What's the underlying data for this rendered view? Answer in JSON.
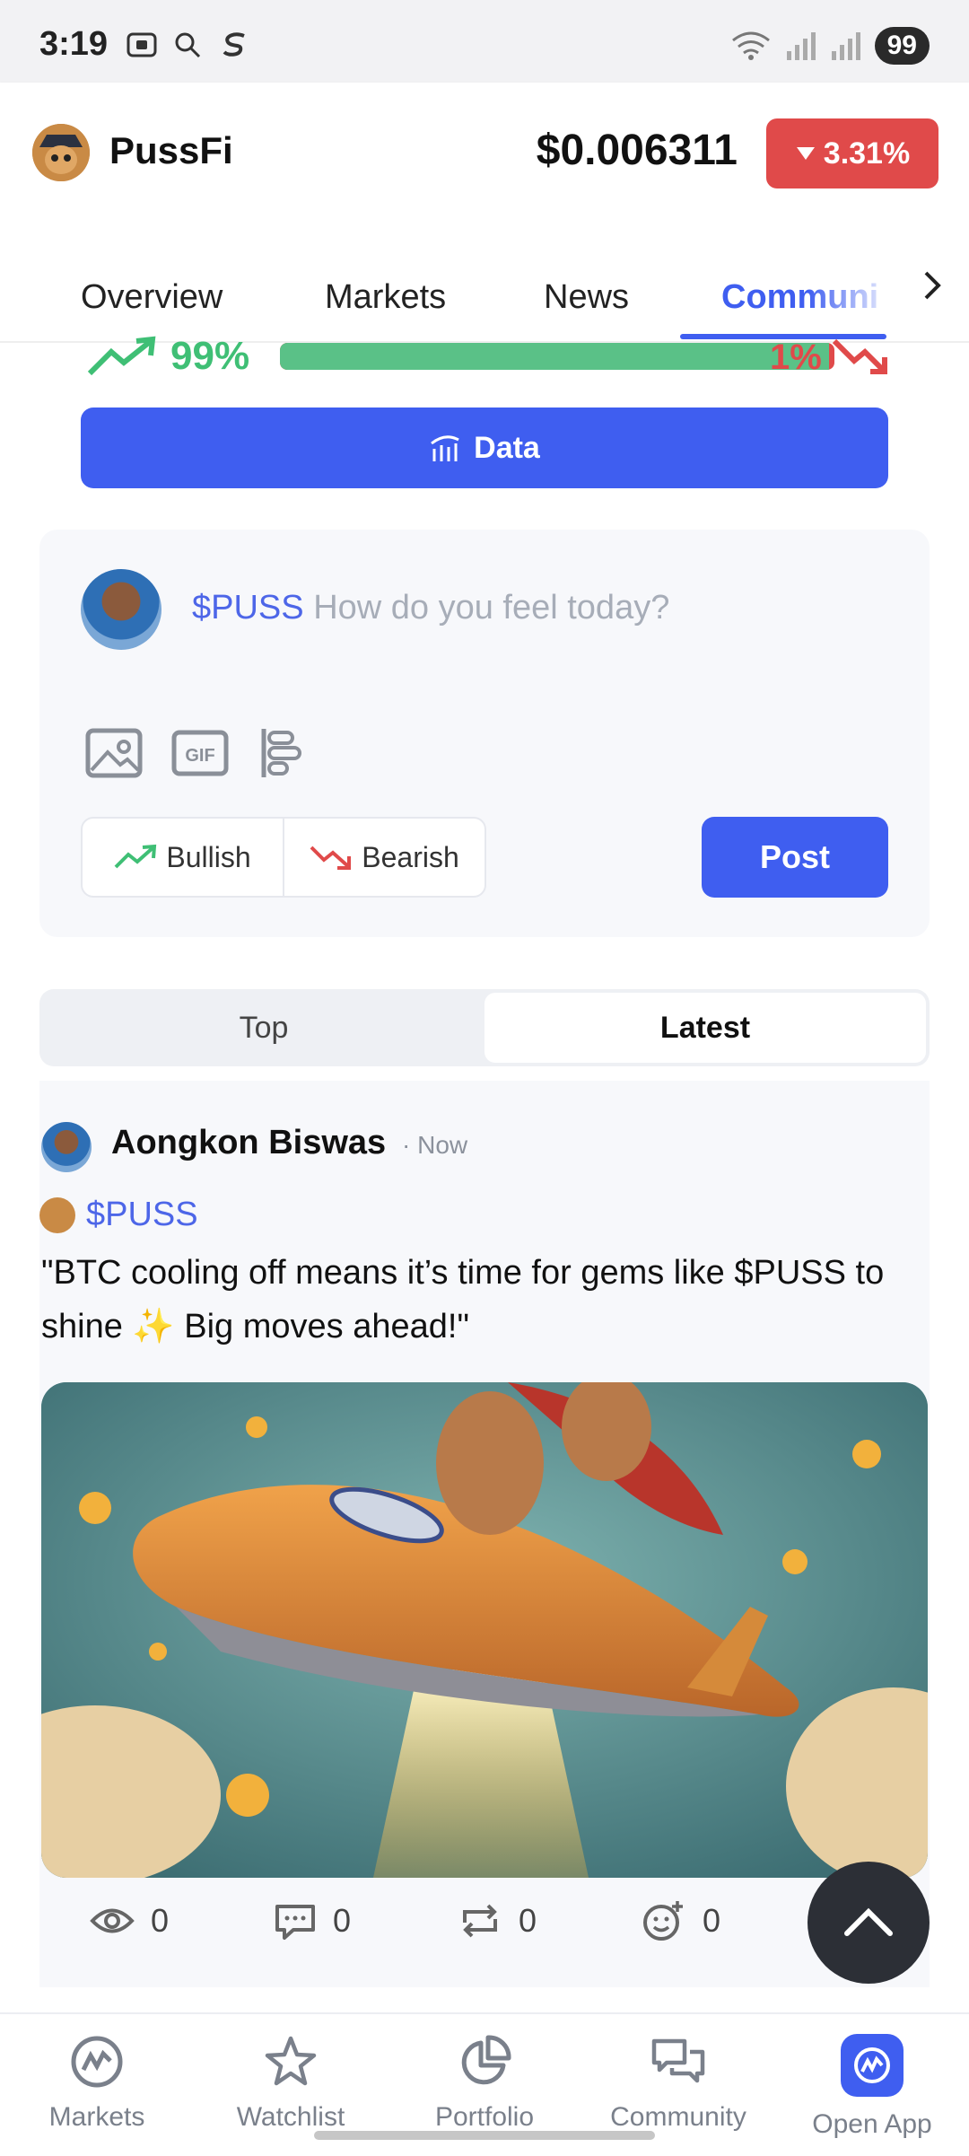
{
  "status_bar": {
    "time": "3:19",
    "battery": "99"
  },
  "header": {
    "token_name": "PussFi",
    "price": "$0.006311",
    "change": "3.31%",
    "change_color": "#e04a4a"
  },
  "tabs": [
    {
      "label": "Overview"
    },
    {
      "label": "Markets"
    },
    {
      "label": "News"
    },
    {
      "label": "Communi"
    }
  ],
  "sentiment": {
    "bullish_pct": "99%",
    "bearish_pct": "1%",
    "bullish_fraction": 0.99
  },
  "data_button": {
    "label": "Data"
  },
  "composer": {
    "ticker": "$PUSS",
    "placeholder": "How do you feel today?",
    "bullish_label": "Bullish",
    "bearish_label": "Bearish",
    "post_label": "Post"
  },
  "sort_tabs": [
    {
      "label": "Top"
    },
    {
      "label": "Latest"
    }
  ],
  "post": {
    "author": "Aongkon Biswas",
    "time": "· Now",
    "ticker": "$PUSS",
    "text": "\"BTC cooling off means it’s time for gems like $PUSS to shine ✨ Big moves ahead!\"",
    "views": "0",
    "comments": "0",
    "reposts": "0",
    "reactions": "0"
  },
  "bottom_nav": [
    {
      "label": "Markets"
    },
    {
      "label": "Watchlist"
    },
    {
      "label": "Portfolio"
    },
    {
      "label": "Community"
    },
    {
      "label": "Open App"
    }
  ],
  "colors": {
    "accent": "#3f5ef0",
    "bull": "#3fbf75",
    "bear": "#e04a4a"
  }
}
